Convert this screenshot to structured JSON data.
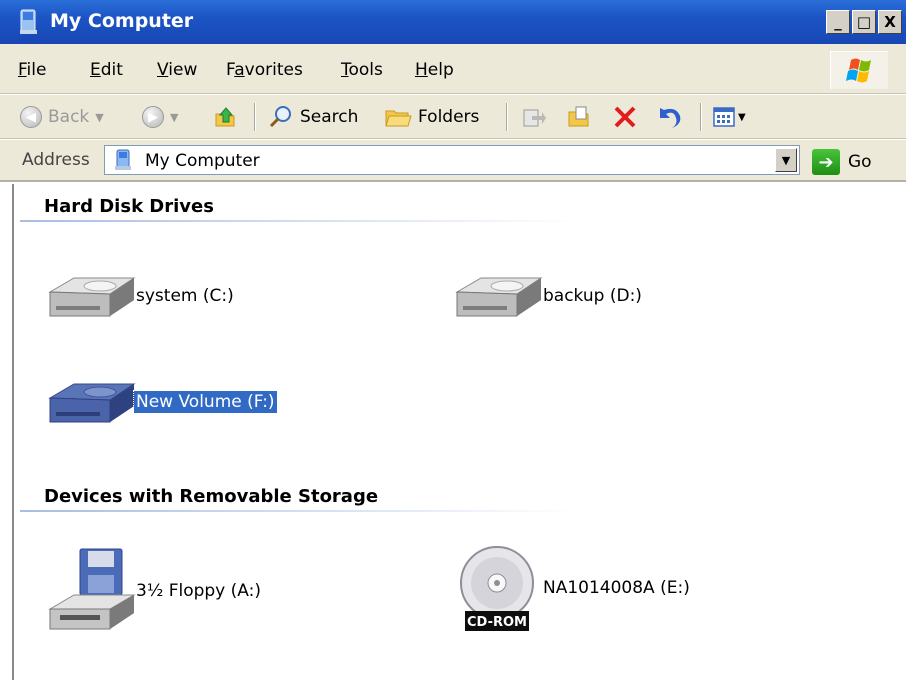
{
  "window": {
    "title": "My Computer",
    "title_icon": "my-computer-icon",
    "controls": {
      "minimize": "_",
      "maximize": "□",
      "close": "X"
    }
  },
  "menu": {
    "items": [
      {
        "label": "File",
        "underline": "F"
      },
      {
        "label": "Edit",
        "underline": "E"
      },
      {
        "label": "View",
        "underline": "V"
      },
      {
        "label": "Favorites",
        "underline": "a"
      },
      {
        "label": "Tools",
        "underline": "T"
      },
      {
        "label": "Help",
        "underline": "H"
      }
    ]
  },
  "toolbar": {
    "back_label": "Back",
    "search_label": "Search",
    "folders_label": "Folders"
  },
  "address": {
    "label": "Address",
    "value": "My Computer",
    "go_label": "Go"
  },
  "groups": [
    {
      "header": "Hard Disk Drives",
      "items": [
        {
          "label": "system (C:)",
          "icon": "hard-drive-icon",
          "selected": false
        },
        {
          "label": "backup (D:)",
          "icon": "hard-drive-icon",
          "selected": false
        },
        {
          "label": "New Volume (F:)",
          "icon": "hard-drive-icon",
          "selected": true
        }
      ]
    },
    {
      "header": "Devices with Removable Storage",
      "items": [
        {
          "label": "3½ Floppy (A:)",
          "icon": "floppy-drive-icon",
          "selected": false
        },
        {
          "label": "NA1014008A (E:)",
          "icon": "cd-rom-icon",
          "badge": "CD-ROM",
          "selected": false
        }
      ]
    }
  ],
  "colors": {
    "titlebar": "#1c54c4",
    "selection": "#316ac5",
    "chrome": "#ece9d8"
  }
}
